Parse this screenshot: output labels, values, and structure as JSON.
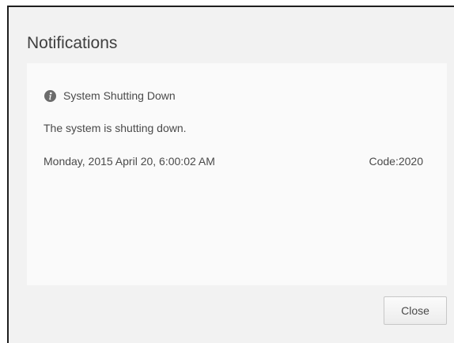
{
  "dialog": {
    "title": "Notifications",
    "close_label": "Close"
  },
  "notification": {
    "icon": "info-icon",
    "title": "System Shutting Down",
    "message": "The system is shutting down.",
    "datetime": "Monday, 2015 April 20, 6:00:02 AM",
    "code": "Code:2020"
  }
}
